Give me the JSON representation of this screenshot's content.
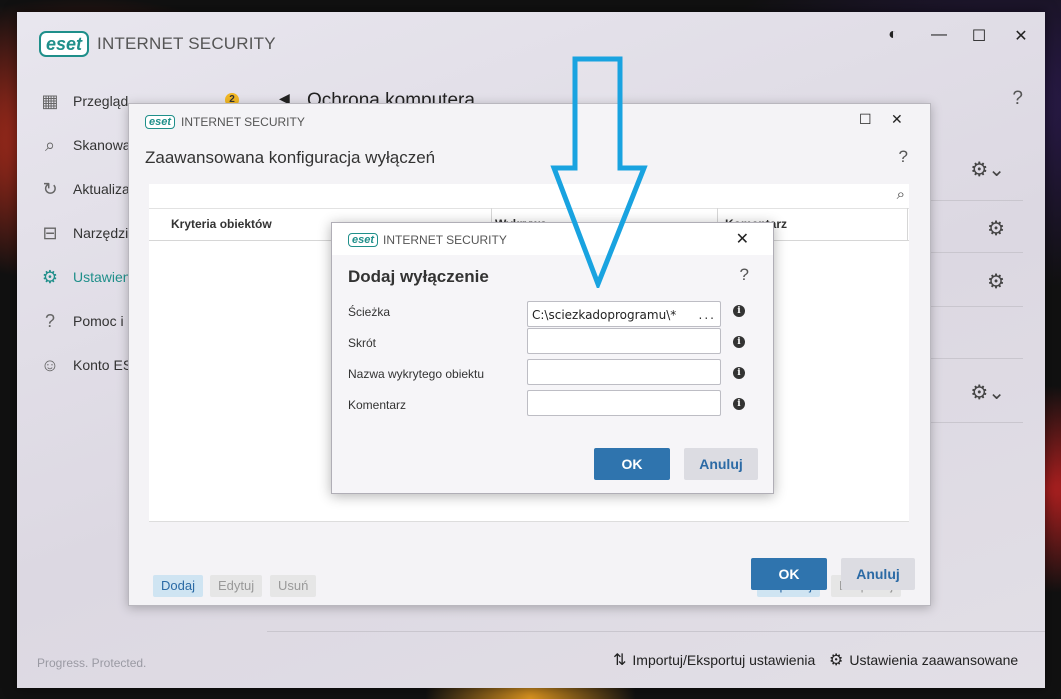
{
  "app": {
    "brand_logo": "eset",
    "brand_name": "INTERNET SECURITY",
    "tagline": "Progress. Protected."
  },
  "sidebar": {
    "items": [
      {
        "label": "Przegląd",
        "icon": "overview-icon"
      },
      {
        "label": "Skanowa",
        "icon": "search-icon"
      },
      {
        "label": "Aktualiza",
        "icon": "refresh-icon"
      },
      {
        "label": "Narzędzia",
        "icon": "briefcase-icon"
      },
      {
        "label": "Ustawien",
        "icon": "gear-icon"
      },
      {
        "label": "Pomoc i",
        "icon": "help-circle-icon"
      },
      {
        "label": "Konto ES",
        "icon": "user-icon"
      }
    ],
    "badge_count": "2"
  },
  "main": {
    "title": "Ochrona komputera",
    "help": "?"
  },
  "footer": {
    "import_export": "Importuj/Eksportuj ustawienia",
    "advanced_settings": "Ustawienia zaawansowane"
  },
  "dialog_exclusions": {
    "brand_name": "INTERNET SECURITY",
    "title": "Zaawansowana konfiguracja wyłączeń",
    "help": "?",
    "columns": [
      "Kryteria obiektów",
      "Wykrywa...",
      "Komentarz"
    ],
    "toolbar": {
      "add": "Dodaj",
      "edit": "Edytuj",
      "delete": "Usuń",
      "import": "Importuj",
      "export": "Eksportuj"
    },
    "ok": "OK",
    "cancel": "Anuluj"
  },
  "dialog_add": {
    "brand_name": "INTERNET SECURITY",
    "title": "Dodaj wyłączenie",
    "help": "?",
    "fields": [
      {
        "label": "Ścieżka",
        "value": "C:\\sciezkadoprogramu\\*",
        "browse": "..."
      },
      {
        "label": "Skrót",
        "value": ""
      },
      {
        "label": "Nazwa wykrytego obiektu",
        "value": ""
      },
      {
        "label": "Komentarz",
        "value": ""
      }
    ],
    "ok": "OK",
    "cancel": "Anuluj"
  },
  "colors": {
    "accent": "#1f8f8a",
    "primary_button": "#2f74ae",
    "arrow": "#19a3e0"
  }
}
